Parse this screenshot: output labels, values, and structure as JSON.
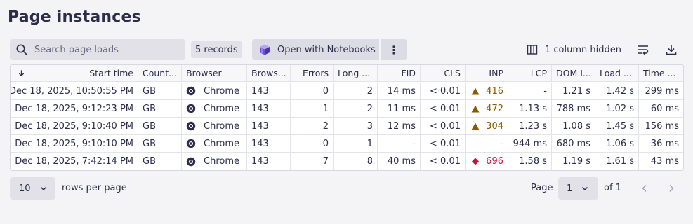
{
  "page": {
    "title": "Page instances"
  },
  "toolbar": {
    "search_placeholder": "Search page loads",
    "records_label": "5 records",
    "notebooks_label": "Open with Notebooks",
    "more_label": "⋮",
    "columns_hidden_label": "1 column hidden"
  },
  "table": {
    "columns": [
      "Start time",
      "Count...",
      "Browser",
      "Brows...",
      "Errors",
      "Long ...",
      "FID",
      "CLS",
      "INP",
      "LCP",
      "DOM I...",
      "Load ...",
      "Time ..."
    ],
    "rows": [
      {
        "start_time": "Dec 18, 2025, 10:50:55 PM",
        "country": "GB",
        "browser": "Chrome",
        "browser_version": "143",
        "errors": "0",
        "long_tasks": "2",
        "fid": "14 ms",
        "cls": "< 0.01",
        "inp": "416",
        "inp_status": "warning",
        "lcp": "-",
        "dom_interactive": "1.21 s",
        "load": "1.42 s",
        "time": "299 ms"
      },
      {
        "start_time": "Dec 18, 2025, 9:12:23 PM",
        "country": "GB",
        "browser": "Chrome",
        "browser_version": "143",
        "errors": "1",
        "long_tasks": "2",
        "fid": "11 ms",
        "cls": "< 0.01",
        "inp": "472",
        "inp_status": "warning",
        "lcp": "1.13 s",
        "dom_interactive": "788 ms",
        "load": "1.02 s",
        "time": "60 ms"
      },
      {
        "start_time": "Dec 18, 2025, 9:10:40 PM",
        "country": "GB",
        "browser": "Chrome",
        "browser_version": "143",
        "errors": "2",
        "long_tasks": "3",
        "fid": "12 ms",
        "cls": "< 0.01",
        "inp": "304",
        "inp_status": "warning",
        "lcp": "1.23 s",
        "dom_interactive": "1.08 s",
        "load": "1.45 s",
        "time": "156 ms"
      },
      {
        "start_time": "Dec 18, 2025, 9:10:10 PM",
        "country": "GB",
        "browser": "Chrome",
        "browser_version": "143",
        "errors": "0",
        "long_tasks": "1",
        "fid": "-",
        "cls": "< 0.01",
        "inp": "-",
        "inp_status": "none",
        "lcp": "944 ms",
        "dom_interactive": "680 ms",
        "load": "1.06 s",
        "time": "36 ms"
      },
      {
        "start_time": "Dec 18, 2025, 7:42:14 PM",
        "country": "GB",
        "browser": "Chrome",
        "browser_version": "143",
        "errors": "7",
        "long_tasks": "8",
        "fid": "40 ms",
        "cls": "< 0.01",
        "inp": "696",
        "inp_status": "critical",
        "lcp": "1.58 s",
        "dom_interactive": "1.19 s",
        "load": "1.61 s",
        "time": "43 ms"
      }
    ]
  },
  "pagination": {
    "rows_per_page_value": "10",
    "rows_per_page_label": "rows per page",
    "page_label": "Page",
    "page_value": "1",
    "of_label": "of 1"
  },
  "colors": {
    "warning": "#8a5a00",
    "critical": "#c4123b",
    "accent": "#6f4fd8"
  },
  "icons": [
    "search-icon",
    "notebooks-icon",
    "more-vert-icon",
    "columns-icon",
    "wrap-lines-icon",
    "download-icon",
    "sort-down-icon",
    "chrome-icon",
    "warning-triangle-icon",
    "critical-diamond-icon",
    "chevron-down-icon",
    "chevron-left-icon",
    "chevron-right-icon"
  ]
}
